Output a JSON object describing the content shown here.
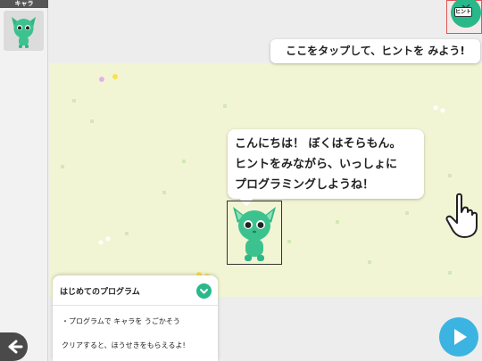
{
  "left_panel": {
    "header_label": "キャラ",
    "character_icon": "green-cat-character-icon"
  },
  "hint": {
    "label": "ヒント",
    "icon": "tv-icon",
    "callout": "ここをタップして、ヒントを みよう!"
  },
  "speech": {
    "lines": [
      "こんにちは！ ぼくはそらもん。",
      "ヒントをみながら、いっしょに",
      "プログラミングしようね！"
    ]
  },
  "character": {
    "name_icon": "green-cat-character"
  },
  "program_panel": {
    "title": "はじめてのプログラム",
    "line1": "・プログラムで キャラを うごかそう",
    "line2": "クリアすると、ほうせきをもらえるよ!"
  },
  "controls": {
    "back_icon": "back-arrow-icon",
    "play_icon": "play-icon",
    "collapse_icon": "chevron-down-icon",
    "tap_icon": "pointing-hand-icon"
  },
  "colors": {
    "stage": "#f2f5d4",
    "accent_green": "#29b88a",
    "play_blue": "#3cb4e2"
  }
}
